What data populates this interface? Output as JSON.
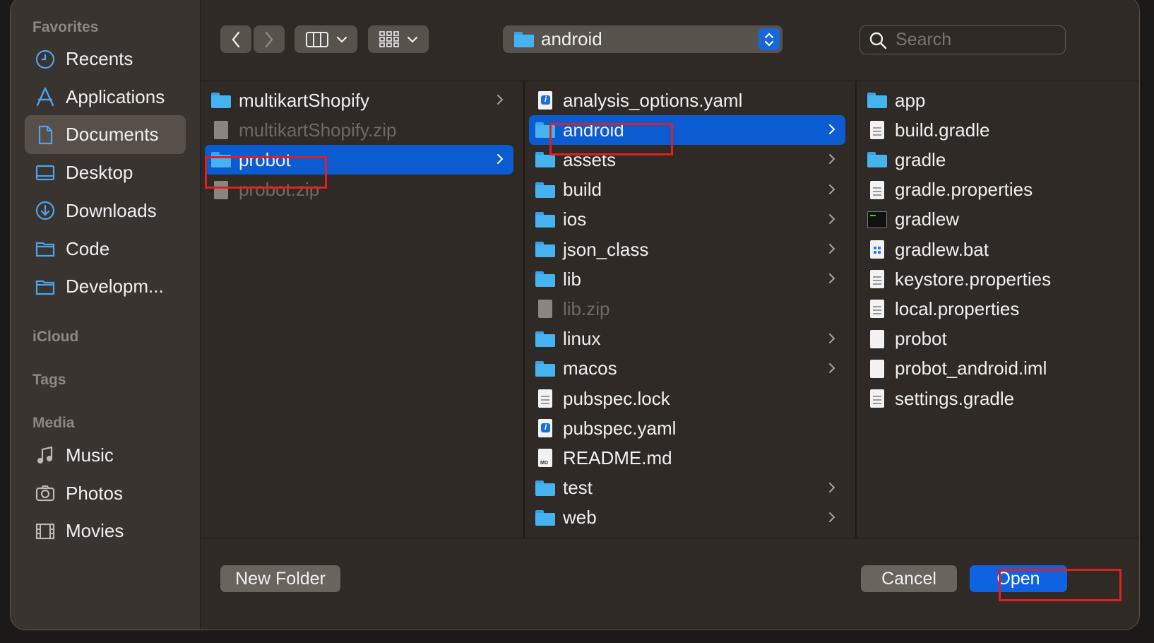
{
  "sidebar": {
    "favorites_title": "Favorites",
    "favorites": [
      {
        "label": "Recents",
        "icon": "clock-icon"
      },
      {
        "label": "Applications",
        "icon": "applications-icon"
      },
      {
        "label": "Documents",
        "icon": "document-icon",
        "active": true
      },
      {
        "label": "Desktop",
        "icon": "desktop-icon"
      },
      {
        "label": "Downloads",
        "icon": "download-icon"
      },
      {
        "label": "Code",
        "icon": "folder-icon"
      },
      {
        "label": "Developm...",
        "icon": "folder-icon"
      }
    ],
    "icloud_title": "iCloud",
    "tags_title": "Tags",
    "media_title": "Media",
    "media": [
      {
        "label": "Music",
        "icon": "music-icon"
      },
      {
        "label": "Photos",
        "icon": "camera-icon"
      },
      {
        "label": "Movies",
        "icon": "film-icon"
      }
    ]
  },
  "toolbar": {
    "path_label": "android",
    "search_placeholder": "Search"
  },
  "columns": [
    [
      {
        "name": "multikartShopify",
        "kind": "folder",
        "chevron": true
      },
      {
        "name": "multikartShopify.zip",
        "kind": "zip",
        "dim": true
      },
      {
        "name": "probot",
        "kind": "folder",
        "chevron": true,
        "selected": true
      },
      {
        "name": "probot.zip",
        "kind": "zip",
        "dim": true
      }
    ],
    [
      {
        "name": "analysis_options.yaml",
        "kind": "yaml"
      },
      {
        "name": "android",
        "kind": "folder",
        "chevron": true,
        "selected": true
      },
      {
        "name": "assets",
        "kind": "folder",
        "chevron": true
      },
      {
        "name": "build",
        "kind": "folder",
        "chevron": true
      },
      {
        "name": "ios",
        "kind": "folder",
        "chevron": true
      },
      {
        "name": "json_class",
        "kind": "folder",
        "chevron": true
      },
      {
        "name": "lib",
        "kind": "folder",
        "chevron": true
      },
      {
        "name": "lib.zip",
        "kind": "zip",
        "dim": true
      },
      {
        "name": "linux",
        "kind": "folder",
        "chevron": true
      },
      {
        "name": "macos",
        "kind": "folder",
        "chevron": true
      },
      {
        "name": "pubspec.lock",
        "kind": "text"
      },
      {
        "name": "pubspec.yaml",
        "kind": "yaml"
      },
      {
        "name": "README.md",
        "kind": "md"
      },
      {
        "name": "test",
        "kind": "folder",
        "chevron": true
      },
      {
        "name": "web",
        "kind": "folder",
        "chevron": true
      }
    ],
    [
      {
        "name": "app",
        "kind": "folder"
      },
      {
        "name": "build.gradle",
        "kind": "text"
      },
      {
        "name": "gradle",
        "kind": "folder"
      },
      {
        "name": "gradle.properties",
        "kind": "text"
      },
      {
        "name": "gradlew",
        "kind": "exec"
      },
      {
        "name": "gradlew.bat",
        "kind": "bat"
      },
      {
        "name": "keystore.properties",
        "kind": "text"
      },
      {
        "name": "local.properties",
        "kind": "text"
      },
      {
        "name": "probot",
        "kind": "blank"
      },
      {
        "name": "probot_android.iml",
        "kind": "blank"
      },
      {
        "name": "settings.gradle",
        "kind": "text"
      }
    ]
  ],
  "footer": {
    "new_folder": "New Folder",
    "cancel": "Cancel",
    "open": "Open"
  }
}
